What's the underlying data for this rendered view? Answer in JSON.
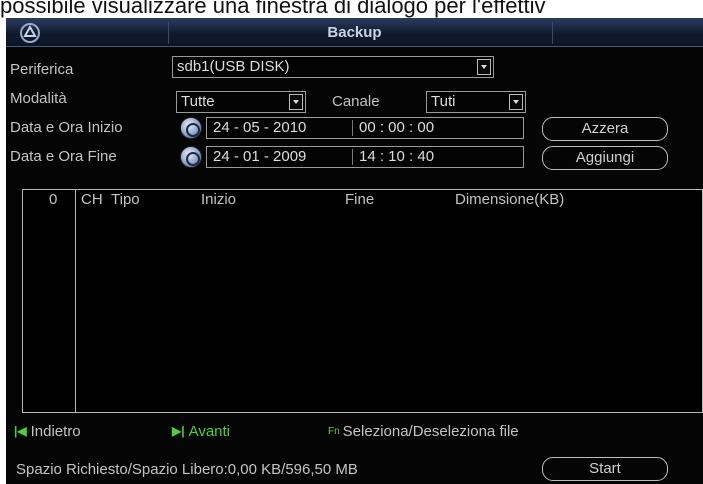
{
  "caption_text": "possibile visualizzare una finestra di dialogo per l'effettiv",
  "window": {
    "title": "Backup",
    "logo_icon": "dahua-logo-icon"
  },
  "form": {
    "device_label": "Periferica",
    "device_value": "sdb1(USB DISK)",
    "mode_label": "Modalità",
    "mode_value": "Tutte",
    "channel_label": "Canale",
    "channel_value": "Tuti",
    "start_label": "Data e Ora Inizio",
    "start_date": "24 - 05 - 2010",
    "start_time": "00 : 00 : 00",
    "end_label": "Data e Ora Fine",
    "end_date": "24 - 01 - 2009",
    "end_time": "14 : 10 : 40"
  },
  "buttons": {
    "reset": "Azzera",
    "add": "Aggiungi",
    "start": "Start"
  },
  "table": {
    "columns": [
      "0",
      "CH",
      "Tipo",
      "Inizio",
      "Fine",
      "Dimensione(KB)"
    ],
    "rows": []
  },
  "nav": {
    "back_icon": "skip-back-icon",
    "back": "Indietro",
    "next_icon": "skip-forward-icon",
    "next": "Avanti",
    "fn_icon": "fn-key-icon",
    "toggle": "Seleziona/Deseleziona file"
  },
  "status": {
    "space": "Spazio Richiesto/Spazio Libero:0,00 KB/596,50 MB"
  },
  "colors": {
    "accent_green": "#4fcf3a",
    "title_bar": "#1a2744",
    "background": "#050505"
  }
}
